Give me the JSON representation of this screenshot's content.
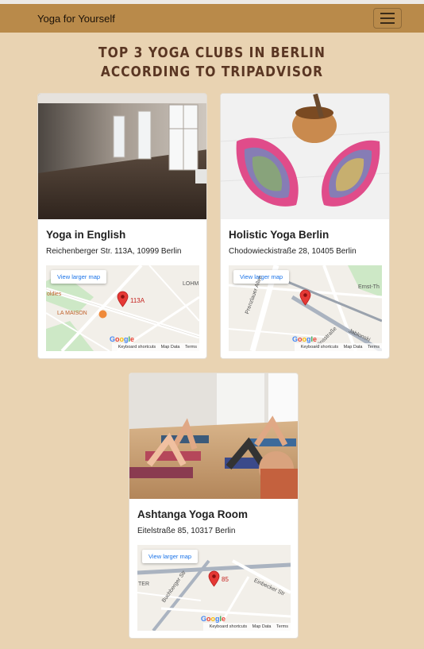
{
  "navbar": {
    "brand": "Yoga for Yourself",
    "menu_icon": "hamburger-menu-icon"
  },
  "heading": "TOP 3 YOGA CLUBS IN BERLIN ACCORDING TO TRIPADVISOR",
  "colors": {
    "page_background": "#e9d3b2",
    "navbar_background": "#b98a4a",
    "heading": "#5a3623",
    "map_pin": "#e53935"
  },
  "clubs": [
    {
      "name": "Yoga in English",
      "address": "Reichenberger Str. 113A, 10999 Berlin",
      "photo": "empty-yoga-studio-photo",
      "map": {
        "button": "View larger map",
        "pin_label": "113A",
        "labels": [
          "LOHM",
          "oldies",
          "LA MAISON"
        ],
        "footer": [
          "Keyboard shortcuts",
          "Map Data",
          "Terms"
        ]
      }
    },
    {
      "name": "Holistic Yoga Berlin",
      "address": "Chodowieckistraße 28, 10405 Berlin",
      "photo": "yoga-bolsters-and-singing-bowl-photo",
      "map": {
        "button": "View larger map",
        "pin_label": "",
        "labels": [
          "Ernst-Th",
          "Prenzlauer Allee",
          "Jablonski",
          "Winsstraße"
        ],
        "footer": [
          "Keyboard shortcuts",
          "Map Data",
          "Terms"
        ]
      }
    },
    {
      "name": "Ashtanga Yoga Room",
      "address": "Eitelstraße 85, 10317 Berlin",
      "photo": "yoga-class-practice-photo",
      "map": {
        "button": "View larger map",
        "pin_label": "85",
        "labels": [
          "TER",
          "Einbecker Str",
          "Buchberger Str"
        ],
        "footer": [
          "Keyboard shortcuts",
          "Map Data",
          "Terms"
        ]
      }
    }
  ],
  "map_logo": "Google"
}
